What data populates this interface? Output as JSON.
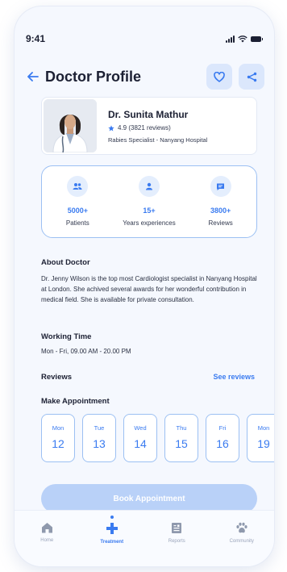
{
  "status_bar": {
    "time": "9:41"
  },
  "header": {
    "title": "Doctor Profile"
  },
  "doctor": {
    "name": "Dr. Sunita Mathur",
    "rating": "4.9 (3821 reviews)",
    "specialty": "Rabies Specialist  -  Nanyang Hospital"
  },
  "stats": [
    {
      "value": "5000+",
      "label": "Patients",
      "icon": "patients-icon"
    },
    {
      "value": "15+",
      "label": "Years experiences",
      "icon": "user-icon"
    },
    {
      "value": "3800+",
      "label": "Reviews",
      "icon": "chat-icon"
    }
  ],
  "about": {
    "title": "About Doctor",
    "text": "Dr. Jenny Wilson is the top most Cardiologist specialist in Nanyang Hospital at London. She achived several awards for her wonderful contribution in medical field. She is available for private consultation."
  },
  "working_time": {
    "title": "Working Time",
    "hours": "Mon - Fri, 09.00 AM - 20.00 PM"
  },
  "reviews": {
    "title": "Reviews",
    "link": "See reviews"
  },
  "appointment": {
    "title": "Make Appointment",
    "days": [
      {
        "name": "Mon",
        "num": "12"
      },
      {
        "name": "Tue",
        "num": "13"
      },
      {
        "name": "Wed",
        "num": "14"
      },
      {
        "name": "Thu",
        "num": "15"
      },
      {
        "name": "Fri",
        "num": "16"
      },
      {
        "name": "Mon",
        "num": "19"
      }
    ],
    "button": "Book Appointment"
  },
  "tabs": [
    {
      "label": "Home",
      "icon": "home-icon"
    },
    {
      "label": "Treatment",
      "icon": "medical-cross-icon"
    },
    {
      "label": "Reports",
      "icon": "reports-icon"
    },
    {
      "label": "Community",
      "icon": "paw-icon"
    }
  ],
  "colors": {
    "accent": "#3a7bf0",
    "accent_light": "#dbe7fc",
    "border": "#9cc0f3",
    "button_disabled": "#b9d1f8"
  }
}
